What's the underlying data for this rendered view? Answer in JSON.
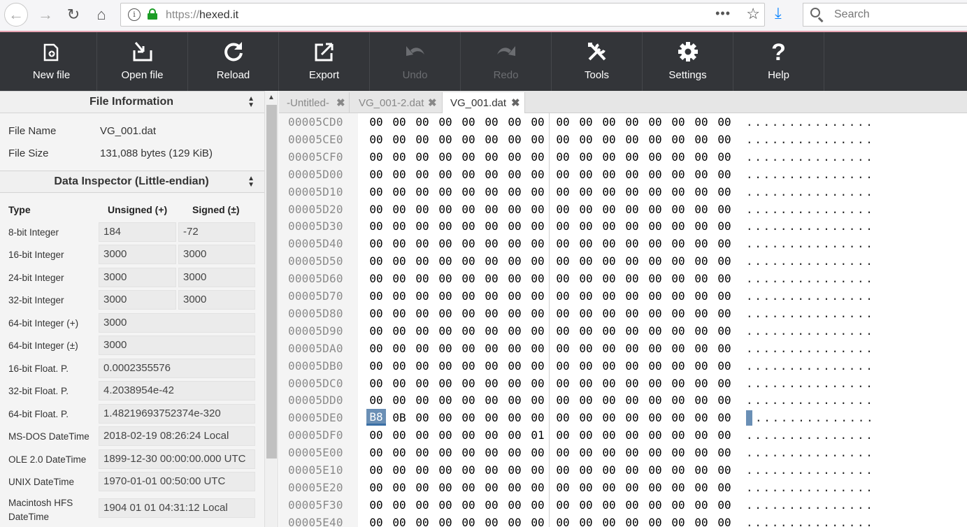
{
  "browser": {
    "url_prefix": "https://",
    "url_host": "hexed.it",
    "search_placeholder": "Search",
    "more_icon": "•••"
  },
  "toolbar": {
    "items": [
      {
        "label": "New file",
        "icon": "new-file-icon",
        "enabled": true
      },
      {
        "label": "Open file",
        "icon": "open-file-icon",
        "enabled": true
      },
      {
        "label": "Reload",
        "icon": "reload-icon",
        "enabled": true
      },
      {
        "label": "Export",
        "icon": "export-icon",
        "enabled": true
      },
      {
        "label": "Undo",
        "icon": "undo-icon",
        "enabled": false
      },
      {
        "label": "Redo",
        "icon": "redo-icon",
        "enabled": false
      },
      {
        "label": "Tools",
        "icon": "tools-icon",
        "enabled": true
      },
      {
        "label": "Settings",
        "icon": "gear-icon",
        "enabled": true
      },
      {
        "label": "Help",
        "icon": "help-icon",
        "enabled": true
      }
    ]
  },
  "file_info": {
    "title": "File Information",
    "name_label": "File Name",
    "name_value": "VG_001.dat",
    "size_label": "File Size",
    "size_value": "131,088 bytes (129 KiB)"
  },
  "inspector": {
    "title": "Data Inspector (Little-endian)",
    "col_type": "Type",
    "col_unsigned": "Unsigned (+)",
    "col_signed": "Signed (±)",
    "rows": [
      {
        "type": "8-bit Integer",
        "unsigned": "184",
        "signed": "-72"
      },
      {
        "type": "16-bit Integer",
        "unsigned": "3000",
        "signed": "3000"
      },
      {
        "type": "24-bit Integer",
        "unsigned": "3000",
        "signed": "3000"
      },
      {
        "type": "32-bit Integer",
        "unsigned": "3000",
        "signed": "3000"
      },
      {
        "type": "64-bit Integer (+)",
        "value": "3000"
      },
      {
        "type": "64-bit Integer (±)",
        "value": "3000"
      },
      {
        "type": "16-bit Float. P.",
        "value": "0.0002355576"
      },
      {
        "type": "32-bit Float. P.",
        "value": "4.2038954e-42"
      },
      {
        "type": "64-bit Float. P.",
        "value": "1.48219693752374e-320"
      },
      {
        "type": "MS-DOS DateTime",
        "value": "2018-02-19 08:26:24 Local"
      },
      {
        "type": "OLE 2.0 DateTime",
        "value": "1899-12-30 00:00:00.000 UTC"
      },
      {
        "type": "UNIX DateTime",
        "value": "1970-01-01 00:50:00 UTC"
      },
      {
        "type": "Macintosh HFS DateTime",
        "value": "1904 01 01 04:31:12 Local"
      }
    ]
  },
  "tabs": [
    {
      "label": "-Untitled-",
      "active": false
    },
    {
      "label": "VG_001-2.dat",
      "active": false
    },
    {
      "label": "VG_001.dat",
      "active": true
    }
  ],
  "hex": {
    "rows": [
      {
        "addr": "00005CD0",
        "bytes": [
          "00",
          "00",
          "00",
          "00",
          "00",
          "00",
          "00",
          "00",
          "00",
          "00",
          "00",
          "00",
          "00",
          "00",
          "00",
          "00"
        ],
        "ascii": "..............."
      },
      {
        "addr": "00005CE0",
        "bytes": [
          "00",
          "00",
          "00",
          "00",
          "00",
          "00",
          "00",
          "00",
          "00",
          "00",
          "00",
          "00",
          "00",
          "00",
          "00",
          "00"
        ],
        "ascii": "..............."
      },
      {
        "addr": "00005CF0",
        "bytes": [
          "00",
          "00",
          "00",
          "00",
          "00",
          "00",
          "00",
          "00",
          "00",
          "00",
          "00",
          "00",
          "00",
          "00",
          "00",
          "00"
        ],
        "ascii": "..............."
      },
      {
        "addr": "00005D00",
        "bytes": [
          "00",
          "00",
          "00",
          "00",
          "00",
          "00",
          "00",
          "00",
          "00",
          "00",
          "00",
          "00",
          "00",
          "00",
          "00",
          "00"
        ],
        "ascii": "..............."
      },
      {
        "addr": "00005D10",
        "bytes": [
          "00",
          "00",
          "00",
          "00",
          "00",
          "00",
          "00",
          "00",
          "00",
          "00",
          "00",
          "00",
          "00",
          "00",
          "00",
          "00"
        ],
        "ascii": "..............."
      },
      {
        "addr": "00005D20",
        "bytes": [
          "00",
          "00",
          "00",
          "00",
          "00",
          "00",
          "00",
          "00",
          "00",
          "00",
          "00",
          "00",
          "00",
          "00",
          "00",
          "00"
        ],
        "ascii": "..............."
      },
      {
        "addr": "00005D30",
        "bytes": [
          "00",
          "00",
          "00",
          "00",
          "00",
          "00",
          "00",
          "00",
          "00",
          "00",
          "00",
          "00",
          "00",
          "00",
          "00",
          "00"
        ],
        "ascii": "..............."
      },
      {
        "addr": "00005D40",
        "bytes": [
          "00",
          "00",
          "00",
          "00",
          "00",
          "00",
          "00",
          "00",
          "00",
          "00",
          "00",
          "00",
          "00",
          "00",
          "00",
          "00"
        ],
        "ascii": "..............."
      },
      {
        "addr": "00005D50",
        "bytes": [
          "00",
          "00",
          "00",
          "00",
          "00",
          "00",
          "00",
          "00",
          "00",
          "00",
          "00",
          "00",
          "00",
          "00",
          "00",
          "00"
        ],
        "ascii": "..............."
      },
      {
        "addr": "00005D60",
        "bytes": [
          "00",
          "00",
          "00",
          "00",
          "00",
          "00",
          "00",
          "00",
          "00",
          "00",
          "00",
          "00",
          "00",
          "00",
          "00",
          "00"
        ],
        "ascii": "..............."
      },
      {
        "addr": "00005D70",
        "bytes": [
          "00",
          "00",
          "00",
          "00",
          "00",
          "00",
          "00",
          "00",
          "00",
          "00",
          "00",
          "00",
          "00",
          "00",
          "00",
          "00"
        ],
        "ascii": "..............."
      },
      {
        "addr": "00005D80",
        "bytes": [
          "00",
          "00",
          "00",
          "00",
          "00",
          "00",
          "00",
          "00",
          "00",
          "00",
          "00",
          "00",
          "00",
          "00",
          "00",
          "00"
        ],
        "ascii": "..............."
      },
      {
        "addr": "00005D90",
        "bytes": [
          "00",
          "00",
          "00",
          "00",
          "00",
          "00",
          "00",
          "00",
          "00",
          "00",
          "00",
          "00",
          "00",
          "00",
          "00",
          "00"
        ],
        "ascii": "..............."
      },
      {
        "addr": "00005DA0",
        "bytes": [
          "00",
          "00",
          "00",
          "00",
          "00",
          "00",
          "00",
          "00",
          "00",
          "00",
          "00",
          "00",
          "00",
          "00",
          "00",
          "00"
        ],
        "ascii": "..............."
      },
      {
        "addr": "00005DB0",
        "bytes": [
          "00",
          "00",
          "00",
          "00",
          "00",
          "00",
          "00",
          "00",
          "00",
          "00",
          "00",
          "00",
          "00",
          "00",
          "00",
          "00"
        ],
        "ascii": "..............."
      },
      {
        "addr": "00005DC0",
        "bytes": [
          "00",
          "00",
          "00",
          "00",
          "00",
          "00",
          "00",
          "00",
          "00",
          "00",
          "00",
          "00",
          "00",
          "00",
          "00",
          "00"
        ],
        "ascii": "..............."
      },
      {
        "addr": "00005DD0",
        "bytes": [
          "00",
          "00",
          "00",
          "00",
          "00",
          "00",
          "00",
          "00",
          "00",
          "00",
          "00",
          "00",
          "00",
          "00",
          "00",
          "00"
        ],
        "ascii": "..............."
      },
      {
        "addr": "00005DE0",
        "bytes": [
          "B8",
          "0B",
          "00",
          "00",
          "00",
          "00",
          "00",
          "00",
          "00",
          "00",
          "00",
          "00",
          "00",
          "00",
          "00",
          "00"
        ],
        "ascii": "..............",
        "selected_index": 0
      },
      {
        "addr": "00005DF0",
        "bytes": [
          "00",
          "00",
          "00",
          "00",
          "00",
          "00",
          "00",
          "01",
          "00",
          "00",
          "00",
          "00",
          "00",
          "00",
          "00",
          "00"
        ],
        "ascii": "..............."
      },
      {
        "addr": "00005E00",
        "bytes": [
          "00",
          "00",
          "00",
          "00",
          "00",
          "00",
          "00",
          "00",
          "00",
          "00",
          "00",
          "00",
          "00",
          "00",
          "00",
          "00"
        ],
        "ascii": "..............."
      },
      {
        "addr": "00005E10",
        "bytes": [
          "00",
          "00",
          "00",
          "00",
          "00",
          "00",
          "00",
          "00",
          "00",
          "00",
          "00",
          "00",
          "00",
          "00",
          "00",
          "00"
        ],
        "ascii": "..............."
      },
      {
        "addr": "00005E20",
        "bytes": [
          "00",
          "00",
          "00",
          "00",
          "00",
          "00",
          "00",
          "00",
          "00",
          "00",
          "00",
          "00",
          "00",
          "00",
          "00",
          "00"
        ],
        "ascii": "..............."
      },
      {
        "addr": "00005F30",
        "bytes": [
          "00",
          "00",
          "00",
          "00",
          "00",
          "00",
          "00",
          "00",
          "00",
          "00",
          "00",
          "00",
          "00",
          "00",
          "00",
          "00"
        ],
        "ascii": "..............."
      },
      {
        "addr": "00005E40",
        "bytes": [
          "00",
          "00",
          "00",
          "00",
          "00",
          "00",
          "00",
          "00",
          "00",
          "00",
          "00",
          "00",
          "00",
          "00",
          "00",
          "00"
        ],
        "ascii": "..............."
      }
    ]
  }
}
